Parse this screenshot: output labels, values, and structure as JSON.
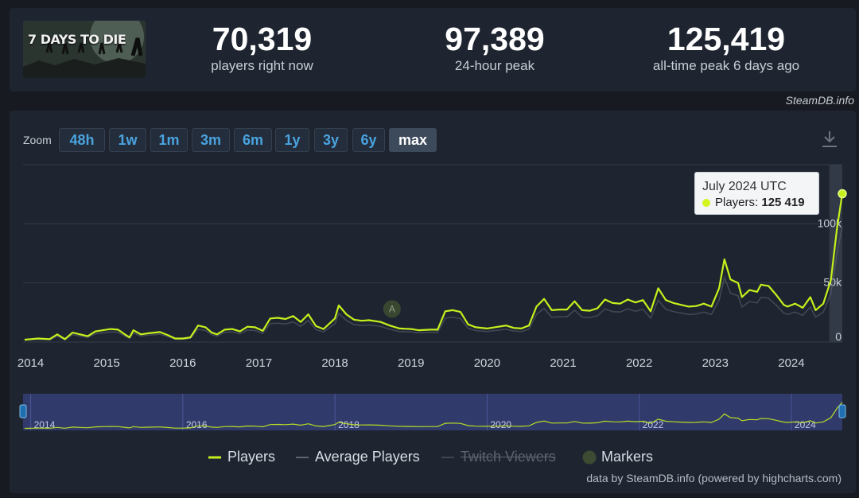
{
  "game": {
    "logo_text": "7 DAYS TO DIE"
  },
  "stats": [
    {
      "value": "70,319",
      "label": "players right now"
    },
    {
      "value": "97,389",
      "label": "24-hour peak"
    },
    {
      "value": "125,419",
      "label": "all-time peak 6 days ago"
    }
  ],
  "credit_top": "SteamDB.info",
  "zoom": {
    "label": "Zoom",
    "buttons": [
      "48h",
      "1w",
      "1m",
      "3m",
      "6m",
      "1y",
      "3y",
      "6y",
      "max"
    ],
    "active": "max"
  },
  "tooltip": {
    "title": "July 2024 UTC",
    "series": "Players:",
    "value": "125 419"
  },
  "legend": [
    "Players",
    "Average Players",
    "Twitch Viewers",
    "Markers"
  ],
  "credit_bottom": "data by SteamDB.info (powered by highcharts.com)",
  "colors": {
    "players": "#c6f01c",
    "average": "#5c6470",
    "background": "#1e2530",
    "accent": "#4aa3df"
  },
  "chart_data": {
    "type": "line",
    "x_unit": "year",
    "xlim": [
      2013.9,
      2024.67
    ],
    "ylim": [
      0,
      150000
    ],
    "y_ticks": [
      0,
      50000,
      100000
    ],
    "y_tick_labels": [
      "0",
      "50k",
      "100k"
    ],
    "x_tick_labels": [
      "2014",
      "2015",
      "2016",
      "2017",
      "2018",
      "2019",
      "2020",
      "2021",
      "2022",
      "2023",
      "2024"
    ],
    "navigator_labels": [
      "2014",
      "2016",
      "2018",
      "2020",
      "2022",
      "2024"
    ],
    "marker_label": "A",
    "marker_x": 2018.75,
    "series": [
      {
        "name": "Players",
        "points": [
          [
            2013.92,
            2000
          ],
          [
            2014.0,
            2500
          ],
          [
            2014.1,
            3000
          ],
          [
            2014.25,
            2500
          ],
          [
            2014.35,
            6500
          ],
          [
            2014.45,
            2500
          ],
          [
            2014.55,
            8000
          ],
          [
            2014.65,
            6500
          ],
          [
            2014.75,
            5000
          ],
          [
            2014.85,
            9000
          ],
          [
            2014.95,
            10000
          ],
          [
            2015.05,
            11000
          ],
          [
            2015.15,
            10500
          ],
          [
            2015.25,
            6000
          ],
          [
            2015.3,
            4000
          ],
          [
            2015.35,
            10000
          ],
          [
            2015.45,
            6500
          ],
          [
            2015.55,
            7500
          ],
          [
            2015.7,
            8500
          ],
          [
            2015.8,
            6000
          ],
          [
            2015.9,
            3000
          ],
          [
            2016.0,
            3000
          ],
          [
            2016.1,
            4000
          ],
          [
            2016.2,
            14000
          ],
          [
            2016.3,
            12500
          ],
          [
            2016.38,
            8000
          ],
          [
            2016.45,
            6500
          ],
          [
            2016.55,
            10500
          ],
          [
            2016.65,
            11000
          ],
          [
            2016.75,
            9000
          ],
          [
            2016.85,
            13000
          ],
          [
            2016.95,
            12500
          ],
          [
            2017.05,
            9500
          ],
          [
            2017.15,
            20000
          ],
          [
            2017.25,
            20500
          ],
          [
            2017.35,
            19500
          ],
          [
            2017.45,
            22000
          ],
          [
            2017.55,
            17000
          ],
          [
            2017.65,
            23500
          ],
          [
            2017.75,
            13500
          ],
          [
            2017.85,
            11000
          ],
          [
            2018.0,
            20000
          ],
          [
            2018.05,
            31000
          ],
          [
            2018.15,
            23500
          ],
          [
            2018.25,
            19000
          ],
          [
            2018.35,
            18000
          ],
          [
            2018.45,
            18500
          ],
          [
            2018.6,
            17000
          ],
          [
            2018.72,
            14000
          ],
          [
            2018.85,
            11500
          ],
          [
            2019.0,
            11000
          ],
          [
            2019.1,
            10000
          ],
          [
            2019.25,
            10500
          ],
          [
            2019.35,
            10500
          ],
          [
            2019.45,
            26000
          ],
          [
            2019.55,
            27000
          ],
          [
            2019.65,
            25500
          ],
          [
            2019.75,
            15000
          ],
          [
            2019.85,
            12500
          ],
          [
            2020.0,
            11500
          ],
          [
            2020.1,
            12500
          ],
          [
            2020.25,
            14000
          ],
          [
            2020.35,
            12000
          ],
          [
            2020.45,
            11500
          ],
          [
            2020.55,
            14000
          ],
          [
            2020.65,
            30000
          ],
          [
            2020.75,
            36500
          ],
          [
            2020.85,
            27000
          ],
          [
            2020.95,
            27500
          ],
          [
            2021.05,
            27500
          ],
          [
            2021.15,
            34500
          ],
          [
            2021.25,
            27000
          ],
          [
            2021.35,
            26500
          ],
          [
            2021.45,
            28500
          ],
          [
            2021.55,
            36000
          ],
          [
            2021.65,
            33000
          ],
          [
            2021.75,
            32500
          ],
          [
            2021.85,
            36000
          ],
          [
            2021.95,
            33500
          ],
          [
            2022.05,
            35500
          ],
          [
            2022.15,
            26000
          ],
          [
            2022.25,
            45500
          ],
          [
            2022.35,
            35500
          ],
          [
            2022.45,
            33000
          ],
          [
            2022.55,
            31500
          ],
          [
            2022.65,
            30000
          ],
          [
            2022.75,
            30500
          ],
          [
            2022.85,
            32500
          ],
          [
            2022.95,
            30000
          ],
          [
            2023.05,
            45500
          ],
          [
            2023.12,
            70000
          ],
          [
            2023.2,
            53000
          ],
          [
            2023.3,
            50000
          ],
          [
            2023.35,
            38000
          ],
          [
            2023.45,
            44000
          ],
          [
            2023.55,
            42500
          ],
          [
            2023.6,
            48500
          ],
          [
            2023.7,
            47500
          ],
          [
            2023.8,
            40000
          ],
          [
            2023.9,
            31500
          ],
          [
            2023.95,
            30000
          ],
          [
            2024.05,
            32500
          ],
          [
            2024.15,
            29000
          ],
          [
            2024.25,
            38000
          ],
          [
            2024.32,
            27000
          ],
          [
            2024.42,
            32500
          ],
          [
            2024.52,
            52500
          ],
          [
            2024.6,
            96000
          ],
          [
            2024.67,
            125419
          ]
        ]
      }
    ]
  }
}
